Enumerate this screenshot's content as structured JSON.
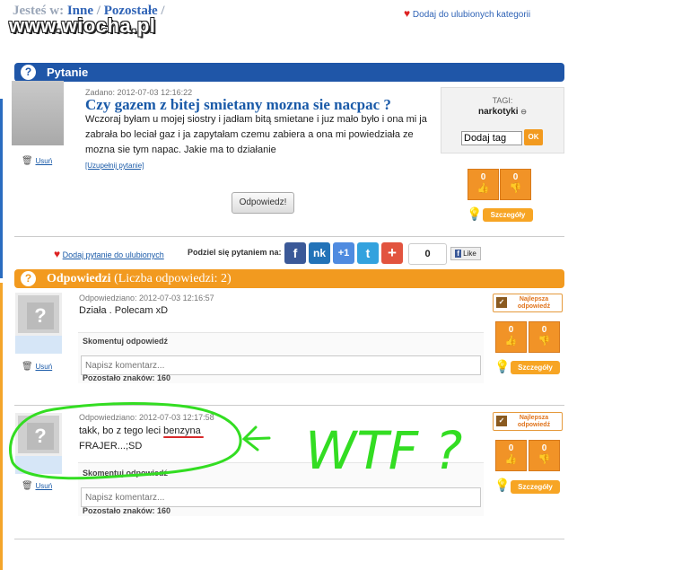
{
  "breadcrumb": {
    "prefix": "Jesteś w:",
    "item1": "Inne",
    "sep": "/",
    "item2": "Pozostałe",
    "trail": "/"
  },
  "watermark": "www.wiocha.pl",
  "favorite_category": "Dodaj do ulubionych kategorii",
  "question": {
    "section_title": "Pytanie",
    "date": "Zadano: 2012-07-03 12:16:22",
    "title": "Czy gazem z bitej smietany mozna sie nacpac ?",
    "body": "Wczoraj byłam u mojej siostry i jadłam bitą smietane i juz mało było i ona mi ja zabrała bo leciał gaz i ja zapytałam czemu zabiera a ona mi powiedziała ze mozna sie tym napac. Jakie ma to działanie",
    "complete_link": "[Uzupełnij pytanie]",
    "delete": "Usuń",
    "answer_button": "Odpowiedz!",
    "votes": {
      "up": "0",
      "down": "0"
    },
    "details": "Szczegóły"
  },
  "tags": {
    "label": "TAGI:",
    "tag": "narkotyki",
    "input_value": "Dodaj tag",
    "ok": "OK"
  },
  "share": {
    "fav": "Dodaj pytanie do ulubionych",
    "label": "Podziel się pytaniem na:",
    "count": "0",
    "like": "Like",
    "buttons": [
      "f",
      "nk",
      "+1",
      "t",
      "+"
    ],
    "colors": {
      "fb": "#3b5998",
      "nk": "#2373b8",
      "gplus": "#4f8be0",
      "tw": "#33a2de",
      "plus": "#e2543f"
    }
  },
  "answers": {
    "section_title": "Odpowiedzi",
    "count_text": "(Liczba odpowiedzi: 2)",
    "items": [
      {
        "date": "Odpowiedziano: 2012-07-03 12:16:57",
        "text": "Działa . Polecam xD",
        "comment_header": "Skomentuj odpowiedź",
        "placeholder": "Napisz komentarz...",
        "remaining": "Pozostało znaków: 160",
        "delete": "Usuń",
        "best": "Najlepsza odpowiedź",
        "votes": {
          "up": "0",
          "down": "0"
        },
        "details": "Szczegóły"
      },
      {
        "date": "Odpowiedziano: 2012-07-03 12:17:58",
        "text_pre": "takk, bo z tego leci ",
        "text_underlined": "benzyna",
        "text_line2": "FRAJER...;SD",
        "comment_header": "Skomentuj odpowiedź",
        "placeholder": "Napisz komentarz...",
        "remaining": "Pozostało znaków: 160",
        "delete": "Usuń",
        "best": "Najlepsza odpowiedź",
        "votes": {
          "up": "0",
          "down": "0"
        },
        "details": "Szczegóły"
      }
    ]
  },
  "annotation": {
    "arrow": "<-",
    "text": "WTF ?",
    "color": "#33dd22"
  }
}
